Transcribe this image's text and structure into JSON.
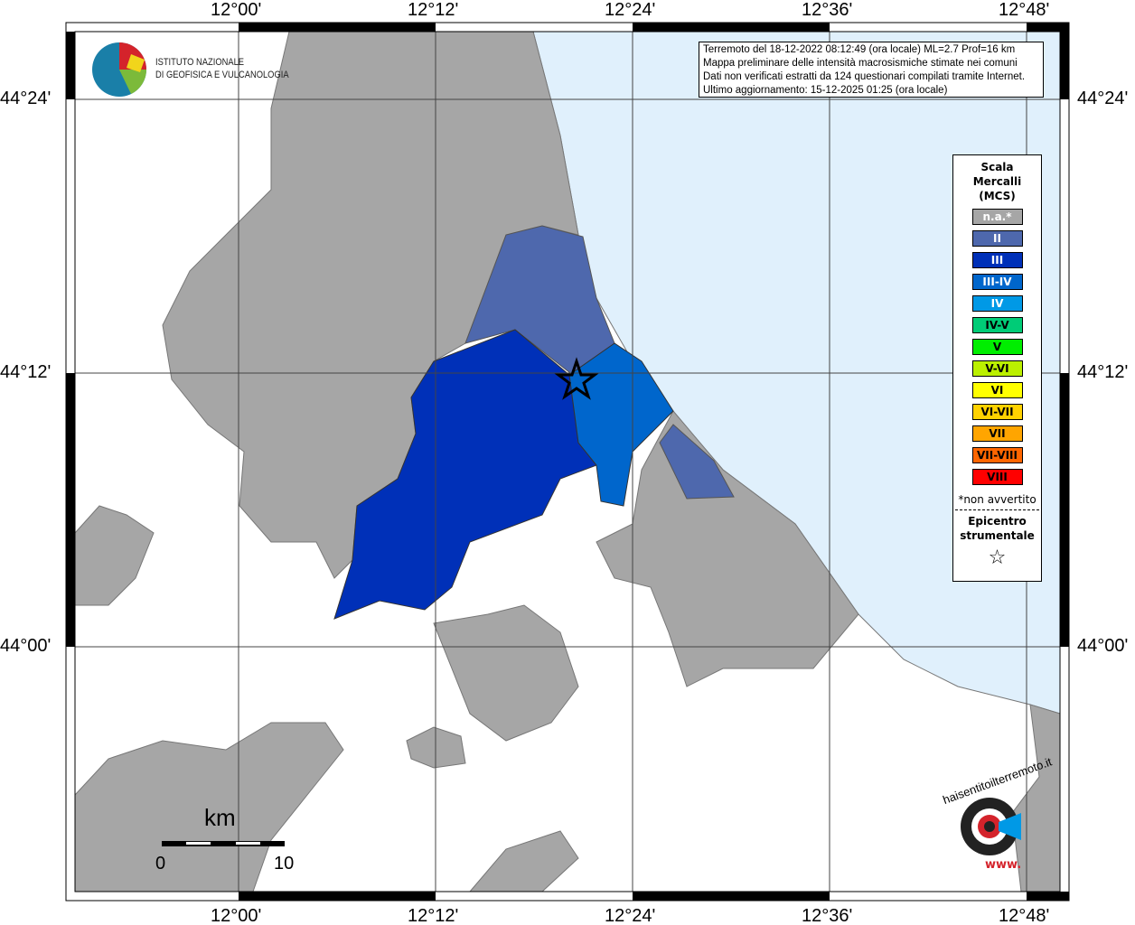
{
  "axes": {
    "lon_labels": [
      "12°00'",
      "12°12'",
      "12°24'",
      "12°36'",
      "12°48'"
    ],
    "lat_labels": [
      "44°24'",
      "44°12'",
      "44°00'"
    ]
  },
  "info": {
    "lines": [
      "Terremoto del 18-12-2022 08:12:49 (ora locale) ML=2.7 Prof=16 km",
      "Mappa preliminare delle intensità macrosismiche stimate nei comuni",
      "Dati non verificati estratti da 124 questionari compilati tramite Internet.",
      "Ultimo aggiornamento: 15-12-2025 01:25 (ora locale)"
    ]
  },
  "logo": {
    "line1": "ISTITUTO NAZIONALE",
    "line2": "DI GEOFISICA E VULCANOLOGIA"
  },
  "legend": {
    "title": [
      "Scala",
      "Mercalli",
      "(MCS)"
    ],
    "items": [
      {
        "label": "n.a.*",
        "color": "#a6a6a6",
        "text": "#fff"
      },
      {
        "label": "II",
        "color": "#4e68ad",
        "text": "#fff"
      },
      {
        "label": "III",
        "color": "#0030b8",
        "text": "#fff"
      },
      {
        "label": "III-IV",
        "color": "#0066cc",
        "text": "#fff"
      },
      {
        "label": "IV",
        "color": "#0099e6",
        "text": "#fff"
      },
      {
        "label": "IV-V",
        "color": "#00cc77",
        "text": "#000"
      },
      {
        "label": "V",
        "color": "#00ee00",
        "text": "#000"
      },
      {
        "label": "V-VI",
        "color": "#bbf000",
        "text": "#000"
      },
      {
        "label": "VI",
        "color": "#ffff00",
        "text": "#000"
      },
      {
        "label": "VI-VII",
        "color": "#ffd200",
        "text": "#000"
      },
      {
        "label": "VII",
        "color": "#ffa500",
        "text": "#000"
      },
      {
        "label": "VII-VIII",
        "color": "#ff6600",
        "text": "#000"
      },
      {
        "label": "VIII",
        "color": "#ff0000",
        "text": "#000"
      }
    ],
    "note": "*non avvertito",
    "epicentre": [
      "Epicentro",
      "strumentale"
    ],
    "star": "☆"
  },
  "scale": {
    "unit": "km",
    "min": "0",
    "max": "10"
  },
  "badge": {
    "text": "haisentitoilterremoto.it",
    "url": "www."
  },
  "colors": {
    "sea": "#e0f0fc",
    "land": "#a6a6a6"
  }
}
